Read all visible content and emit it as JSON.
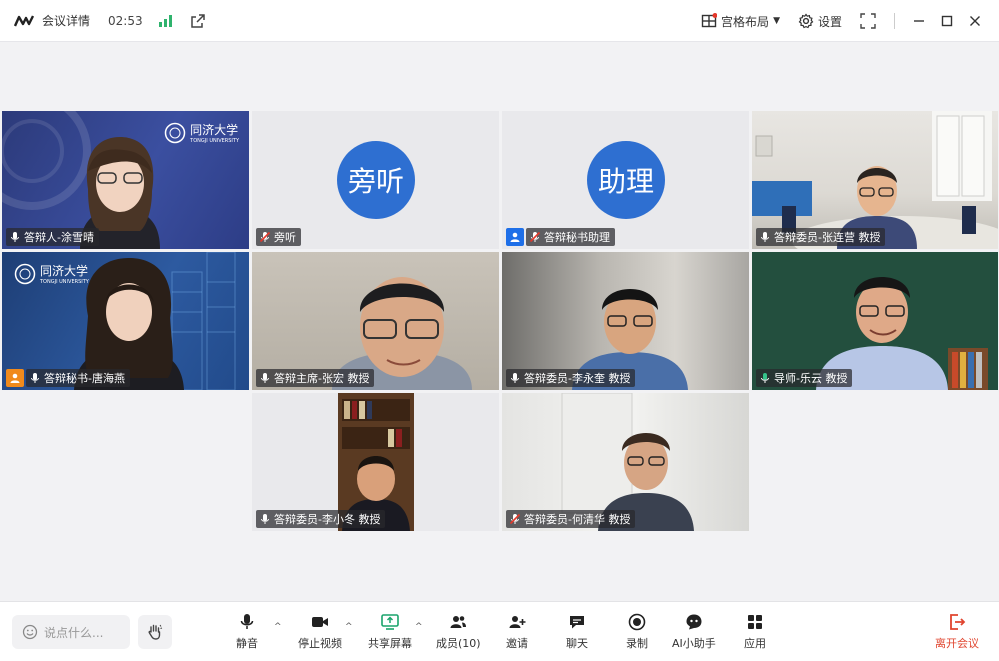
{
  "titlebar": {
    "title": "会议详情",
    "time": "02:53",
    "layout_label": "宫格布局",
    "settings_label": "设置"
  },
  "tiles": [
    {
      "name": "答辩人-涂雪晴",
      "mic": "on",
      "logo": "同济大学",
      "logo_sub": "TONGJI UNIVERSITY"
    },
    {
      "name": "旁听",
      "mic": "muted",
      "avatar": "旁听"
    },
    {
      "name": "答辩秘书助理",
      "mic": "muted",
      "avatar": "助理",
      "badge": "blue"
    },
    {
      "name": "答辩委员-张连营 教授",
      "mic": "on"
    },
    {
      "name": "答辩秘书-唐海燕",
      "mic": "on",
      "badge": "orange",
      "logo": "同济大学",
      "logo_sub": "TONGJI UNIVERSITY"
    },
    {
      "name": "答辩主席-张宏 教授",
      "mic": "on"
    },
    {
      "name": "答辩委员-李永奎 教授",
      "mic": "on"
    },
    {
      "name": "导师-乐云 教授",
      "mic": "on"
    },
    {
      "name": "答辩委员-李小冬 教授",
      "mic": "on"
    },
    {
      "name": "答辩委员-何清华 教授",
      "mic": "muted"
    }
  ],
  "toolbar": {
    "chat_placeholder": "说点什么...",
    "mute": "静音",
    "stop_video": "停止视频",
    "share": "共享屏幕",
    "members": "成员(10)",
    "invite": "邀请",
    "chat": "聊天",
    "record": "录制",
    "ai": "AI小助手",
    "apps": "应用",
    "leave": "离开会议"
  },
  "colors": {
    "accent": "#2e6fd1",
    "active_speaker": "#35c28a",
    "signal": "#2fb36d",
    "leave": "#e0452f",
    "host_badge": "#f08a1c"
  }
}
